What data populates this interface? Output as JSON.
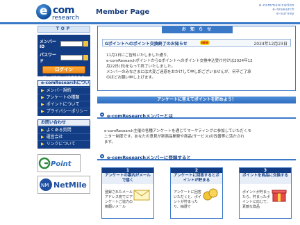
{
  "header": {
    "logo_main": "com",
    "logo_e": "e",
    "logo_sub": "research",
    "page_title": "Member Page",
    "tagline": [
      "e-communication",
      "e-research",
      "e-survey"
    ]
  },
  "sidebar": {
    "top_label": "TOP",
    "login": {
      "member_id_label": "メンバーID",
      "password_label": "パスワード",
      "login_button": "ログイン",
      "forgot_link": "ID・パスワードを忘れたら"
    },
    "about_group": {
      "title": "e-comResearchについて",
      "items": [
        "メンバー規約",
        "アンケートの種類",
        "ポイントについて",
        "プライバシーポリシー"
      ]
    },
    "contact_group": {
      "title": "お問い合わせ",
      "items": [
        "よくある質問",
        "運営会社",
        "リンクについて"
      ]
    },
    "banners": {
      "gpoint": "G-Point",
      "netmile": "NetMile"
    }
  },
  "news": {
    "tab_label": "お 知 ら せ",
    "title": "Gポイントへのポイント交換終了のお知らせ",
    "badge": "NEW",
    "date": "2024年12月23日",
    "body": [
      "11月1日にご告知いたしました通り、",
      "e-comResearchポイントからGポイントへのポイント交換申込受け付けは2024年12",
      "月22日(日)をもって終了いたしました。",
      "メンバーのみなさまには大変ご迷惑をおかけして申し訳ございませんが、何卒ご了承",
      "のほどお願い申し上げます。"
    ]
  },
  "promo_band": "アンケートに答えてポイントを貯めよう！",
  "section_about": {
    "title": "e-comResearchメンバーとは",
    "body": [
      "e-comResearch主催の各種アンケートを通じてマーケティングに参加していただくモ",
      "ニター制度です。あなたの意見が新商品開発や商品(サービス)の改善等に活かされ",
      "ます。"
    ]
  },
  "section_register": {
    "title": "e-comResearchメンバーに登録すると",
    "steps": [
      {
        "num": "1",
        "title": "アンケートの案内がメールで届く",
        "body": "登録されたメールアドレス宛てにアンケートご協力の御願いメール"
      },
      {
        "num": "2",
        "title": "アンケートに回答するとポイントが貯まる",
        "body": "アンケートに回答いただくと、ポイントが貯まったり、抽選で"
      },
      {
        "num": "3",
        "title": "ポイントを商品に交換する",
        "body": "ポイントが貯まったら、貯まったポイントに応じて、素敵な賞品"
      }
    ]
  }
}
